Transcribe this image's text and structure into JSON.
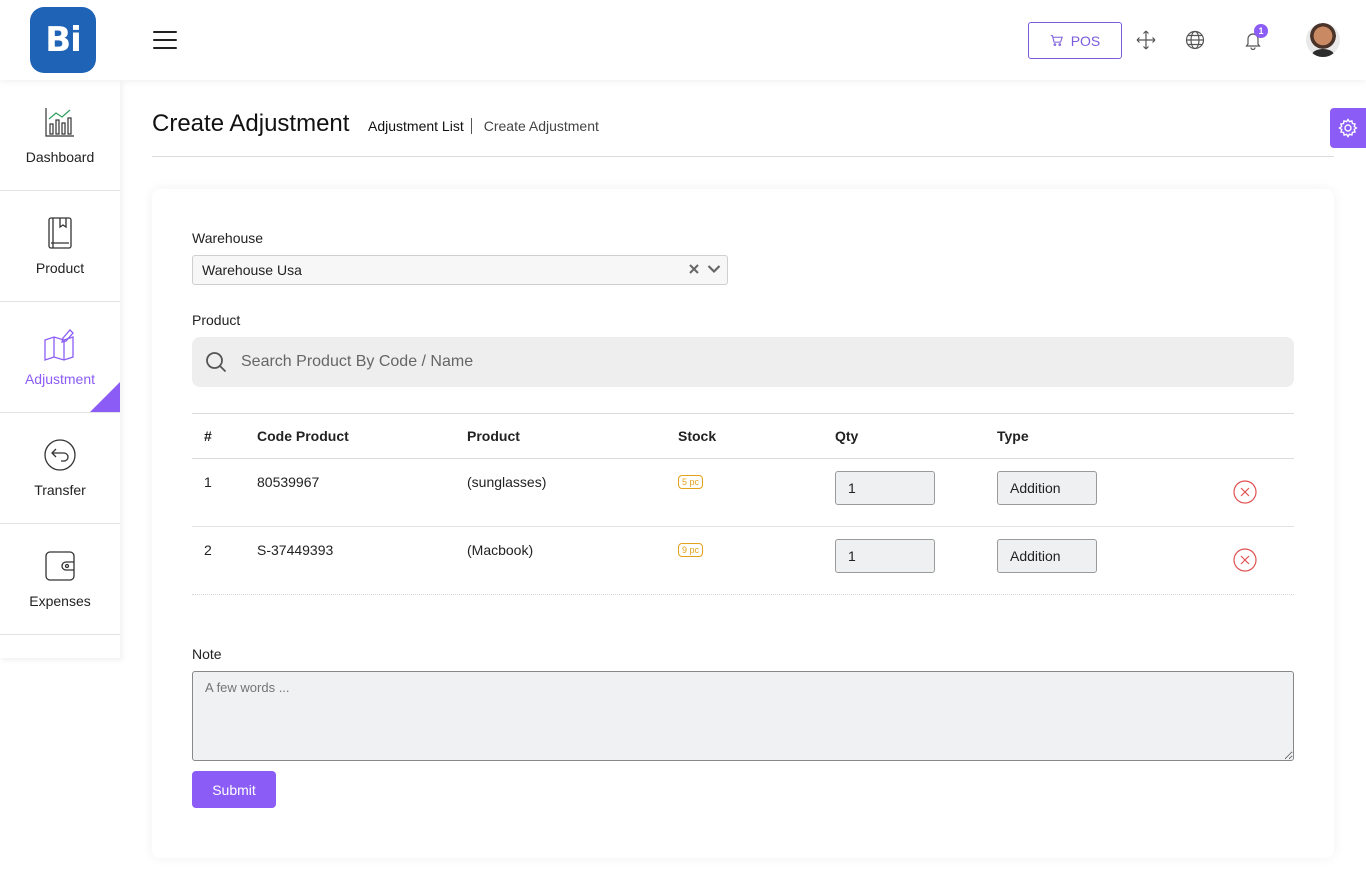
{
  "app": {
    "logo_text": "Bi",
    "brand_color": "#1e63b6",
    "accent_color": "#8b5cf6"
  },
  "topbar": {
    "pos_label": "POS",
    "notification_count": "1",
    "icons": [
      "menu-icon",
      "cart-icon",
      "fullscreen-icon",
      "globe-icon",
      "bell-icon",
      "avatar"
    ]
  },
  "sidebar": {
    "items": [
      {
        "label": "Dashboard",
        "icon": "chart-icon",
        "active": false
      },
      {
        "label": "Product",
        "icon": "book-icon",
        "active": false
      },
      {
        "label": "Adjustment",
        "icon": "map-pencil-icon",
        "active": true
      },
      {
        "label": "Transfer",
        "icon": "arrow-back-icon",
        "active": false
      },
      {
        "label": "Expenses",
        "icon": "wallet-icon",
        "active": false
      }
    ]
  },
  "header": {
    "title": "Create Adjustment",
    "breadcrumb_link": "Adjustment List",
    "breadcrumb_current": "Create Adjustment"
  },
  "form": {
    "warehouse_label": "Warehouse",
    "warehouse_value": "Warehouse Usa",
    "product_label": "Product",
    "search_placeholder": "Search Product By Code / Name",
    "note_label": "Note",
    "note_placeholder": "A few words ...",
    "submit_label": "Submit"
  },
  "table": {
    "headers": [
      "#",
      "Code Product",
      "Product",
      "Stock",
      "Qty",
      "Type"
    ],
    "rows": [
      {
        "index": "1",
        "code": "80539967",
        "product": "(sunglasses)",
        "stock": "5 pc",
        "qty": "1",
        "type": "Addition"
      },
      {
        "index": "2",
        "code": "S-37449393",
        "product": "(Macbook)",
        "stock": "9 pc",
        "qty": "1",
        "type": "Addition"
      }
    ]
  }
}
